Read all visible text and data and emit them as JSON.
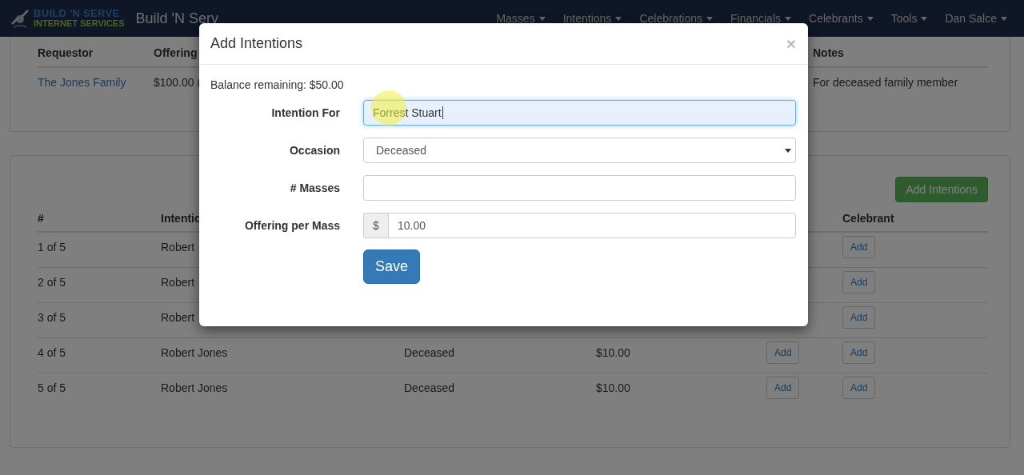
{
  "navbar": {
    "brand_line_1": "BUILD 'N SERVE",
    "brand_line_2": "INTERNET SERVICES",
    "title": "Build 'N Serv",
    "menus": [
      {
        "label": "Masses"
      },
      {
        "label": "Intentions"
      },
      {
        "label": "Celebrations"
      },
      {
        "label": "Financials"
      },
      {
        "label": "Celebrants"
      },
      {
        "label": "Tools"
      },
      {
        "label": "Dan Salce"
      }
    ]
  },
  "request_table": {
    "columns": [
      "Requestor",
      "Offering",
      "Notes"
    ],
    "rows": [
      {
        "requestor": "The Jones Family",
        "offering": "$100.00 (",
        "notes": "For deceased family member"
      }
    ]
  },
  "intentions_panel": {
    "add_button": "Add Intentions",
    "headers": {
      "number": "#",
      "intention": "Intentio",
      "celebrant": "Celebrant"
    },
    "rows": [
      {
        "number": "1 of 5",
        "intention": "Robert",
        "celebrant_button": "Add"
      },
      {
        "number": "2 of 5",
        "intention": "Robert",
        "celebrant_button": "Add"
      },
      {
        "number": "3 of 5",
        "intention": "Robert",
        "celebrant_button": "Add"
      },
      {
        "number": "4 of 5",
        "intention": "Robert Jones",
        "column_3": "Deceased",
        "column_4": "$10.00",
        "column_5_button": "Add",
        "celebrant_button": "Add"
      },
      {
        "number": "5 of 5",
        "intention": "Robert Jones",
        "column_3": "Deceased",
        "column_4": "$10.00",
        "column_5_button": "Add",
        "celebrant_button": "Add"
      }
    ]
  },
  "modal": {
    "title": "Add Intentions",
    "close": "×",
    "balance": "Balance remaining: $50.00",
    "fields": [
      {
        "kind": "text",
        "label": "Intention For",
        "value": "Forrest Stuart",
        "focused": true
      },
      {
        "kind": "select",
        "label": "Occasion",
        "value": "Deceased",
        "focused": false
      },
      {
        "kind": "text",
        "label": "# Masses",
        "focused": false
      },
      {
        "kind": "money",
        "label": "Offering per Mass",
        "prefix": "$",
        "value": "10.00",
        "focused": false
      }
    ],
    "save_button": "Save"
  }
}
